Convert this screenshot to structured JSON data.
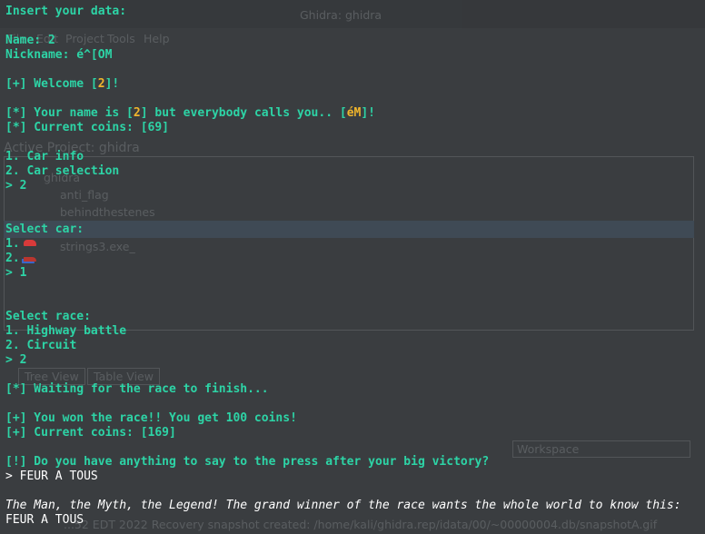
{
  "background_app": {
    "window_title": "Ghidra: ghidra",
    "menu": [
      "File",
      "Edit",
      "Project",
      "Tools",
      "Help"
    ],
    "active_project_label": "Active Project: ghidra",
    "tree_root": "ghidra",
    "tree_items": [
      "anti_flag",
      "behindthestenes",
      "...",
      "strings3.exe_"
    ],
    "tabs": [
      "Tree View",
      "Table View"
    ],
    "workspace": "Workspace",
    "status": "...52 EDT 2022 Recovery snapshot created: /home/kali/ghidra.rep/idata/00/~00000004.db/snapshotA.gif"
  },
  "terminal": {
    "prompt_header": "Insert your data:",
    "name_line": "Name: 2",
    "nickname_line": "Nickname: é^[OM",
    "welcome": {
      "prefix": "[+] Welcome [",
      "value": "2",
      "suffix": "]!"
    },
    "name_is": {
      "prefix": "[*] Your name is [",
      "name": "2",
      "middle": "] but everybody calls you.. [",
      "nick": "éM",
      "suffix": "]!"
    },
    "coins_before": "[*] Current coins: [69]",
    "menu_1": "1. Car info",
    "menu_2": "2. Car selection",
    "menu_choice": "> 2",
    "select_car": "Select car:",
    "car_1": "1.",
    "car_2": "2.",
    "car_choice": "> 1",
    "select_race": "Select race:",
    "race_1": "1. Highway battle",
    "race_2": "2. Circuit",
    "race_choice": "> 2",
    "waiting": "[*] Waiting for the race to finish...",
    "won": "[+] You won the race!! You get 100 coins!",
    "coins_after": "[+] Current coins: [169]",
    "press_question": "[!] Do you have anything to say to the press after your big victory?",
    "press_answer": "> FEUR A TOUS",
    "legend_line": "The Man, the Myth, the Legend! The grand winner of the race wants the whole world to know this:",
    "echo": "FEUR A TOUS"
  }
}
